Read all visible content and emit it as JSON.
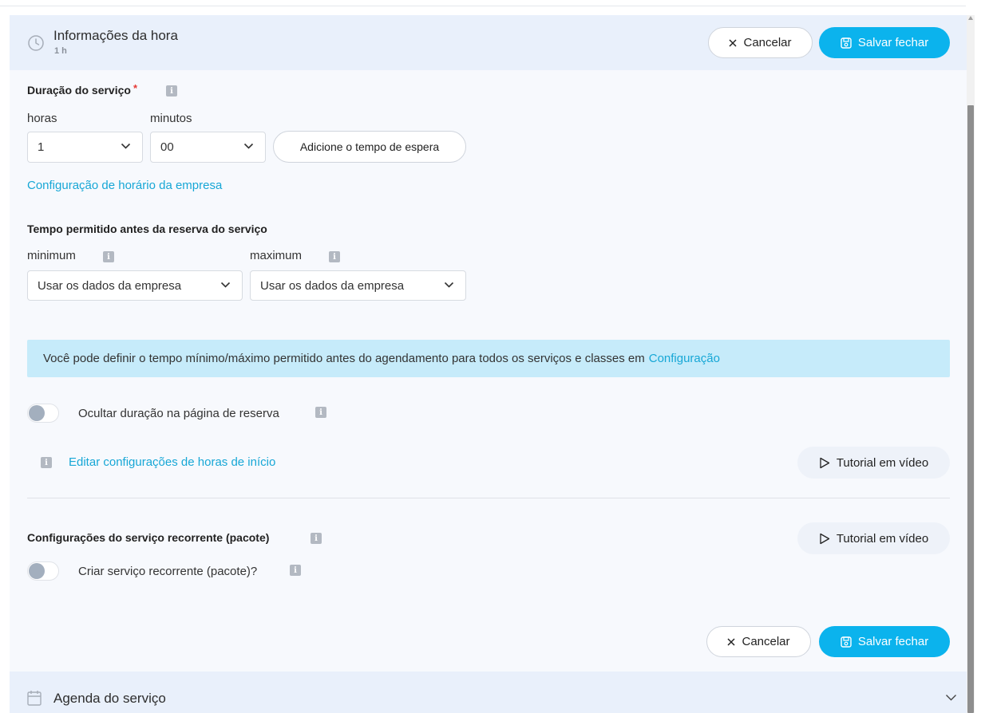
{
  "header": {
    "title": "Informações da hora",
    "subtitle": "1 h",
    "cancel_label": "Cancelar",
    "save_label": "Salvar fechar"
  },
  "duration": {
    "label": "Duração do serviço",
    "required_mark": "*",
    "hours_label": "horas",
    "hours_value": "1",
    "minutes_label": "minutos",
    "minutes_value": "00",
    "add_wait_label": "Adicione o tempo de espera",
    "company_hours_link": "Configuração de horário da empresa"
  },
  "booking_window": {
    "label": "Tempo permitido antes da reserva do serviço",
    "minimum_label": "minimum",
    "minimum_value": "Usar os dados da empresa",
    "maximum_label": "maximum",
    "maximum_value": "Usar os dados da empresa"
  },
  "alert": {
    "text": "Você pode definir o tempo mínimo/máximo permitido antes do agendamento para todos os serviços e classes em",
    "link": "Configuração"
  },
  "hide_duration": {
    "label": "Ocultar duração na página de reserva",
    "enabled": false
  },
  "start_times": {
    "link": "Editar configurações de horas de início",
    "tutorial_label": "Tutorial em vídeo"
  },
  "recurring": {
    "title": "Configurações do serviço recorrente (pacote)",
    "tutorial_label": "Tutorial em vídeo",
    "toggle_label": "Criar serviço recorrente (pacote)?",
    "enabled": false
  },
  "footer": {
    "cancel_label": "Cancelar",
    "save_label": "Salvar fechar"
  },
  "schedule_section": {
    "title": "Agenda do serviço"
  },
  "colors": {
    "accent": "#0bb3ed",
    "link": "#17a7d6",
    "alert_bg": "#c6ebfa",
    "header_bg": "#e9f0fb",
    "required": "#e53935"
  }
}
